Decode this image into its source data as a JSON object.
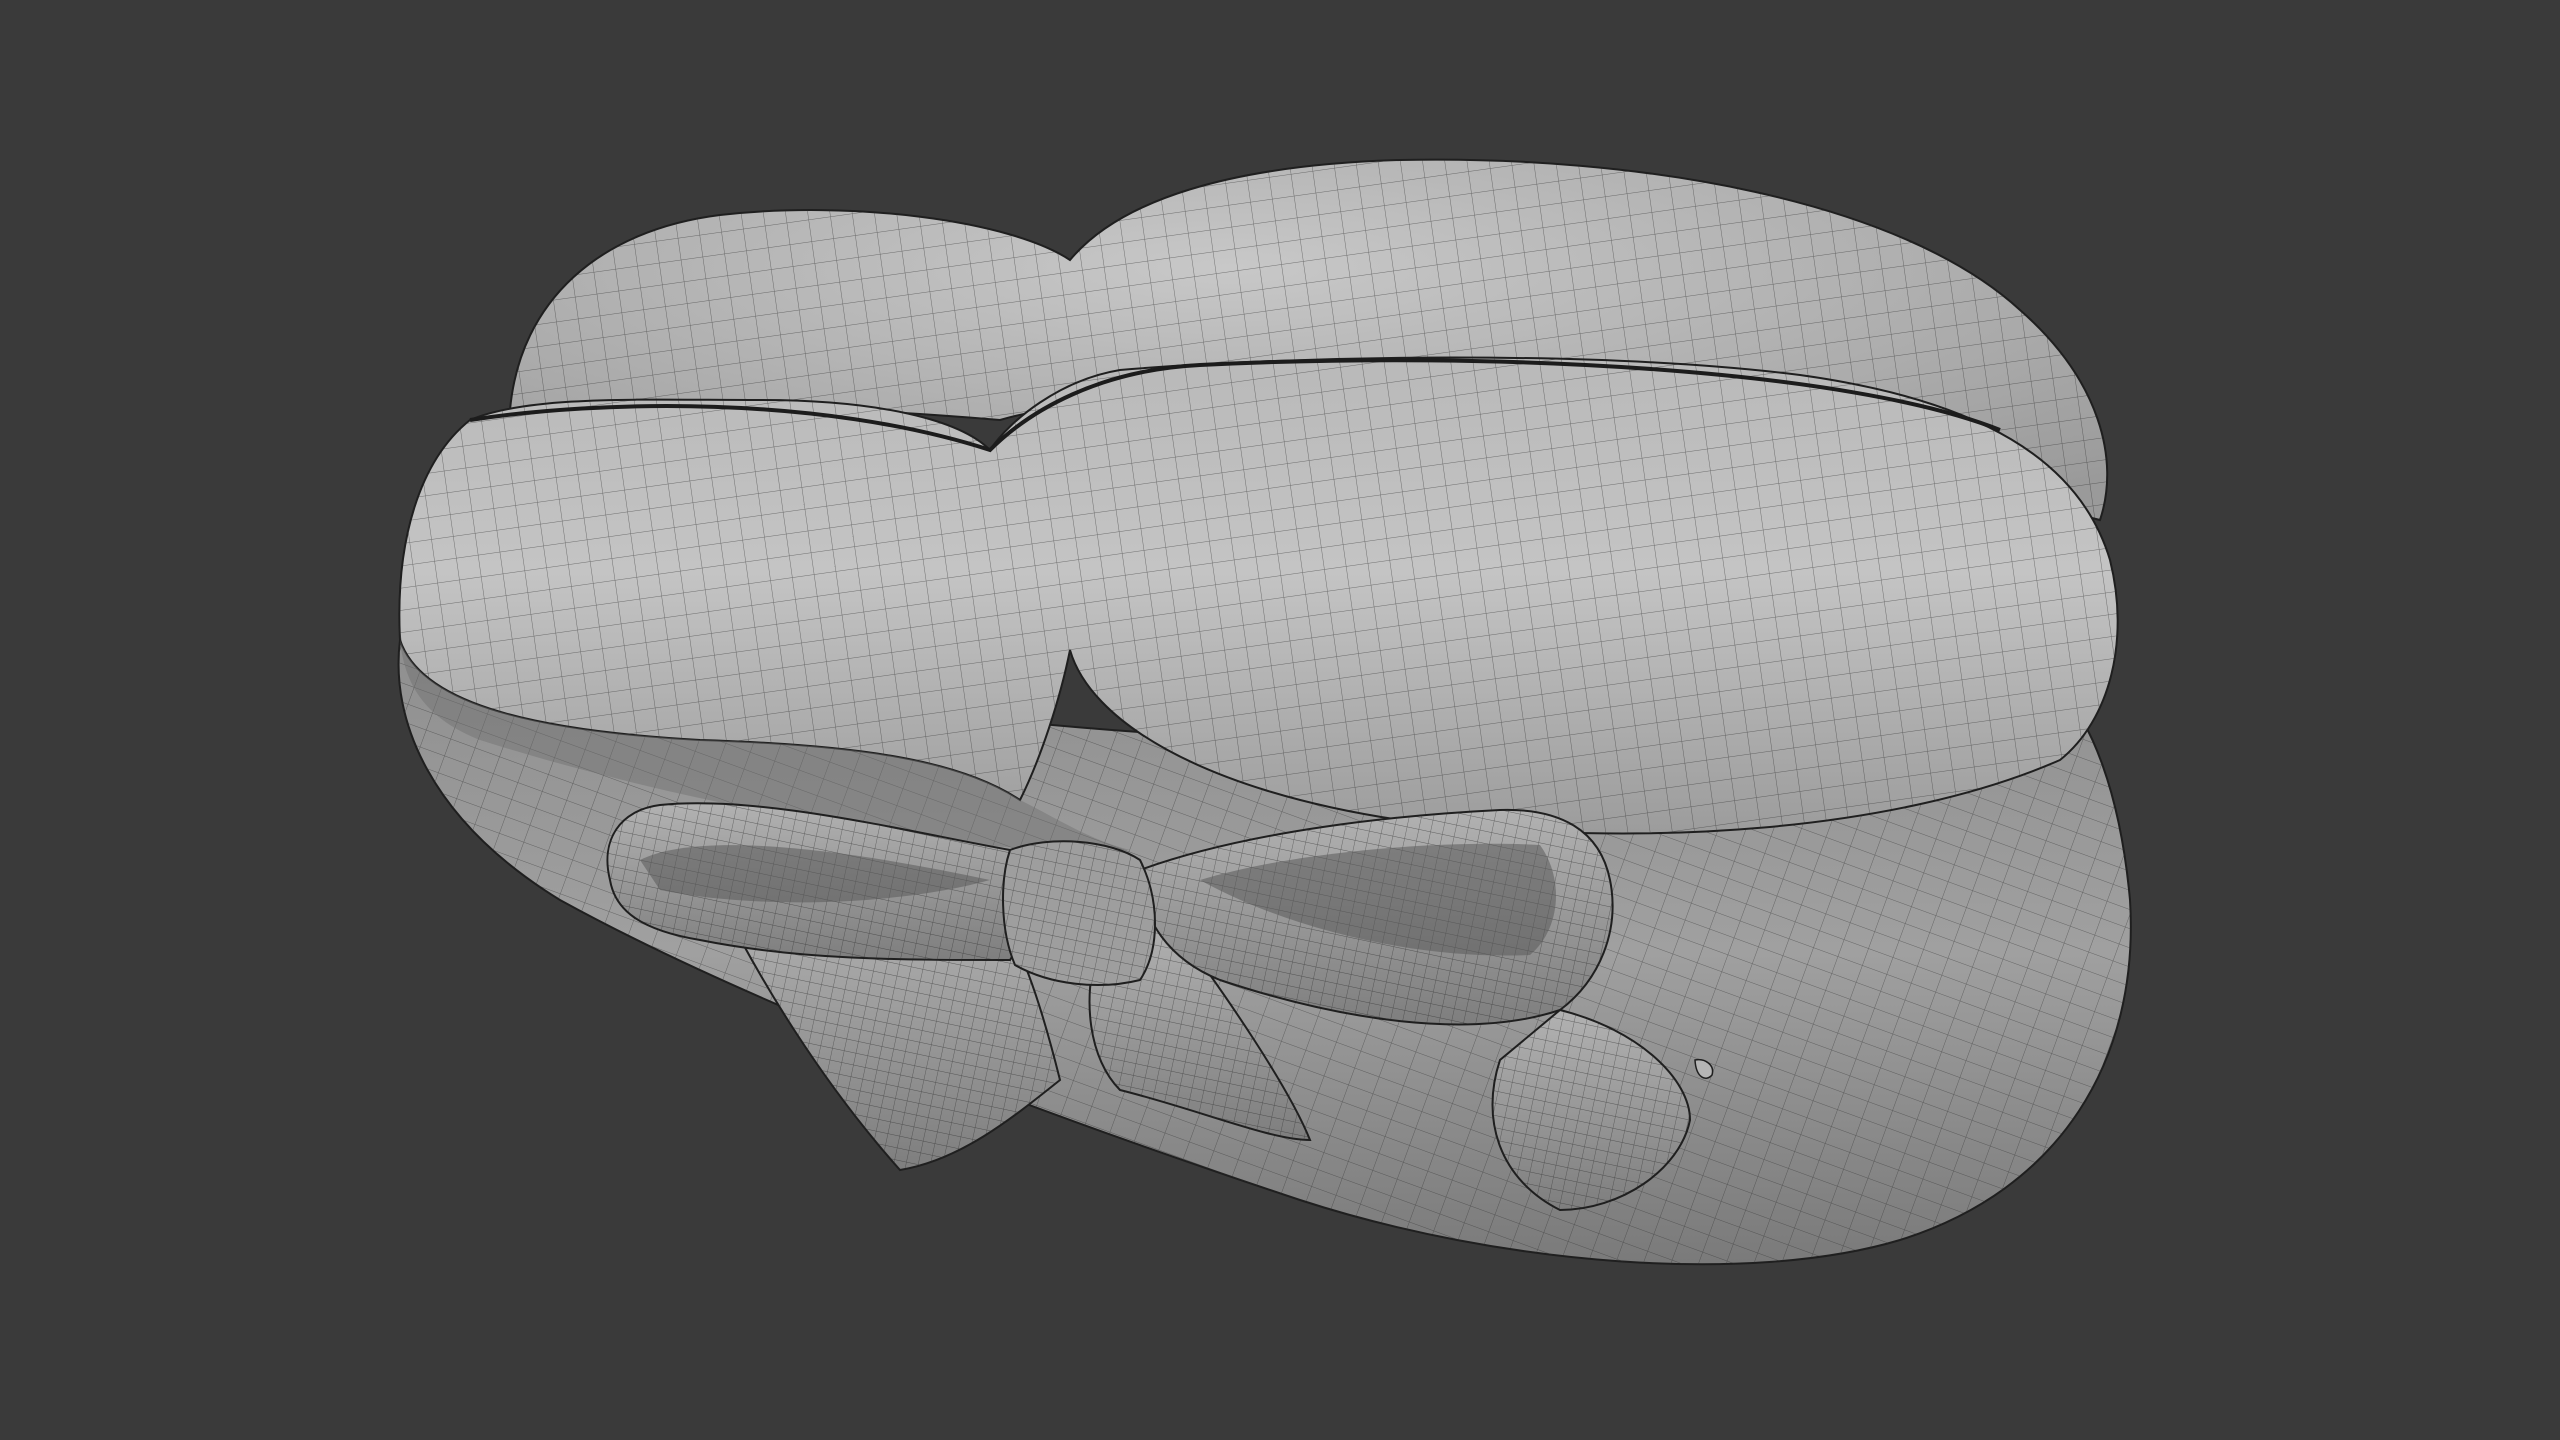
{
  "viewport": {
    "background_color": "#3a3a3a",
    "shading": "solid-matcap-with-wireframe-overlay",
    "wire_color": "#2b2b2b",
    "surface_color": "#a9a9a9"
  },
  "scene": {
    "object": "heart-shaped-box-with-bow",
    "parts": [
      "box-base",
      "box-lid",
      "lid-seam",
      "bow-left-loop",
      "bow-right-loop",
      "bow-knot",
      "bow-left-tail",
      "bow-right-tail",
      "small-pin"
    ]
  }
}
